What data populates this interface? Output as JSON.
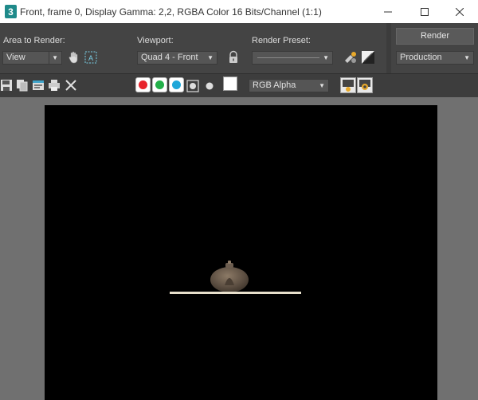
{
  "window": {
    "title": "Front, frame 0, Display Gamma: 2,2, RGBA Color 16 Bits/Channel (1:1)",
    "minimize_glyph": "—",
    "maximize_glyph": "☐",
    "close_glyph": "✕"
  },
  "controls": {
    "area_label": "Area to Render:",
    "area_value": "View",
    "viewport_label": "Viewport:",
    "viewport_value": "Quad 4 - Front",
    "preset_label": "Render Preset:",
    "preset_value": "",
    "render_button": "Render",
    "production_value": "Production"
  },
  "toolbar": {
    "channel_value": "RGB Alpha",
    "channels": [
      {
        "name": "red",
        "color": "#e8232b"
      },
      {
        "name": "green",
        "color": "#23b04a"
      },
      {
        "name": "blue",
        "color": "#1fa7d9"
      }
    ]
  },
  "icons": {
    "app": "3ds-max-icon",
    "save": "save-icon",
    "copy": "copy-icon",
    "clone": "clone-window-icon",
    "print": "print-icon",
    "clear": "clear-icon",
    "lock": "lock-icon"
  }
}
